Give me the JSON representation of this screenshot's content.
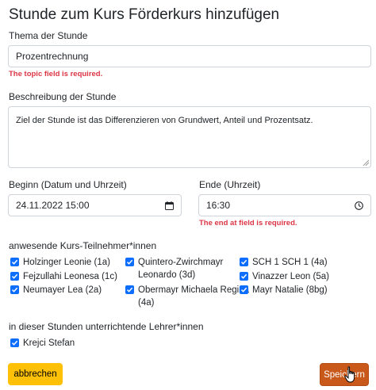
{
  "page_title": "Stunde zum Kurs Förderkurs hinzufügen",
  "topic": {
    "label": "Thema der Stunde",
    "value": "Prozentrechnung",
    "error": "The topic field is required."
  },
  "description": {
    "label": "Beschreibung der Stunde",
    "value": "Ziel der Stunde ist das Differenzieren von Grundwert, Anteil und Prozentsatz."
  },
  "begin": {
    "label": "Beginn (Datum und Uhrzeit)",
    "value": "24.11.2022 15:00",
    "icon": "calendar-icon"
  },
  "end": {
    "label": "Ende (Uhrzeit)",
    "value": "16:30",
    "icon": "clock-icon",
    "error": "The end at field is required."
  },
  "participants": {
    "label": "anwesende Kurs-Teilnehmer*innen",
    "items": [
      {
        "name": "Holzinger Leonie (1a)",
        "checked": true
      },
      {
        "name": "Fejzullahi Leonesa (1c)",
        "checked": true
      },
      {
        "name": "Neumayer Lea (2a)",
        "checked": true
      },
      {
        "name": "Quintero-Zwirchmayr",
        "name_line2": "Leonardo (3d)",
        "checked": true
      },
      {
        "name": "Obermayr Michaela Regina",
        "name_line2": "(4a)",
        "checked": true
      },
      {
        "name": "SCH 1 SCH 1 (4a)",
        "checked": true
      },
      {
        "name": "Vinazzer Leon (5a)",
        "checked": true
      },
      {
        "name": "Mayr Natalie (8bg)",
        "checked": true
      }
    ]
  },
  "teachers": {
    "label": "in dieser Stunden unterrichtende Lehrer*innen",
    "items": [
      {
        "name": "Krejci Stefan",
        "checked": true
      }
    ]
  },
  "buttons": {
    "cancel": "abbrechen",
    "save": "Speichern"
  },
  "colors": {
    "primary": "#0d6efd",
    "danger": "#dc3545",
    "warning": "#ffc107",
    "save": "#c9591b"
  }
}
